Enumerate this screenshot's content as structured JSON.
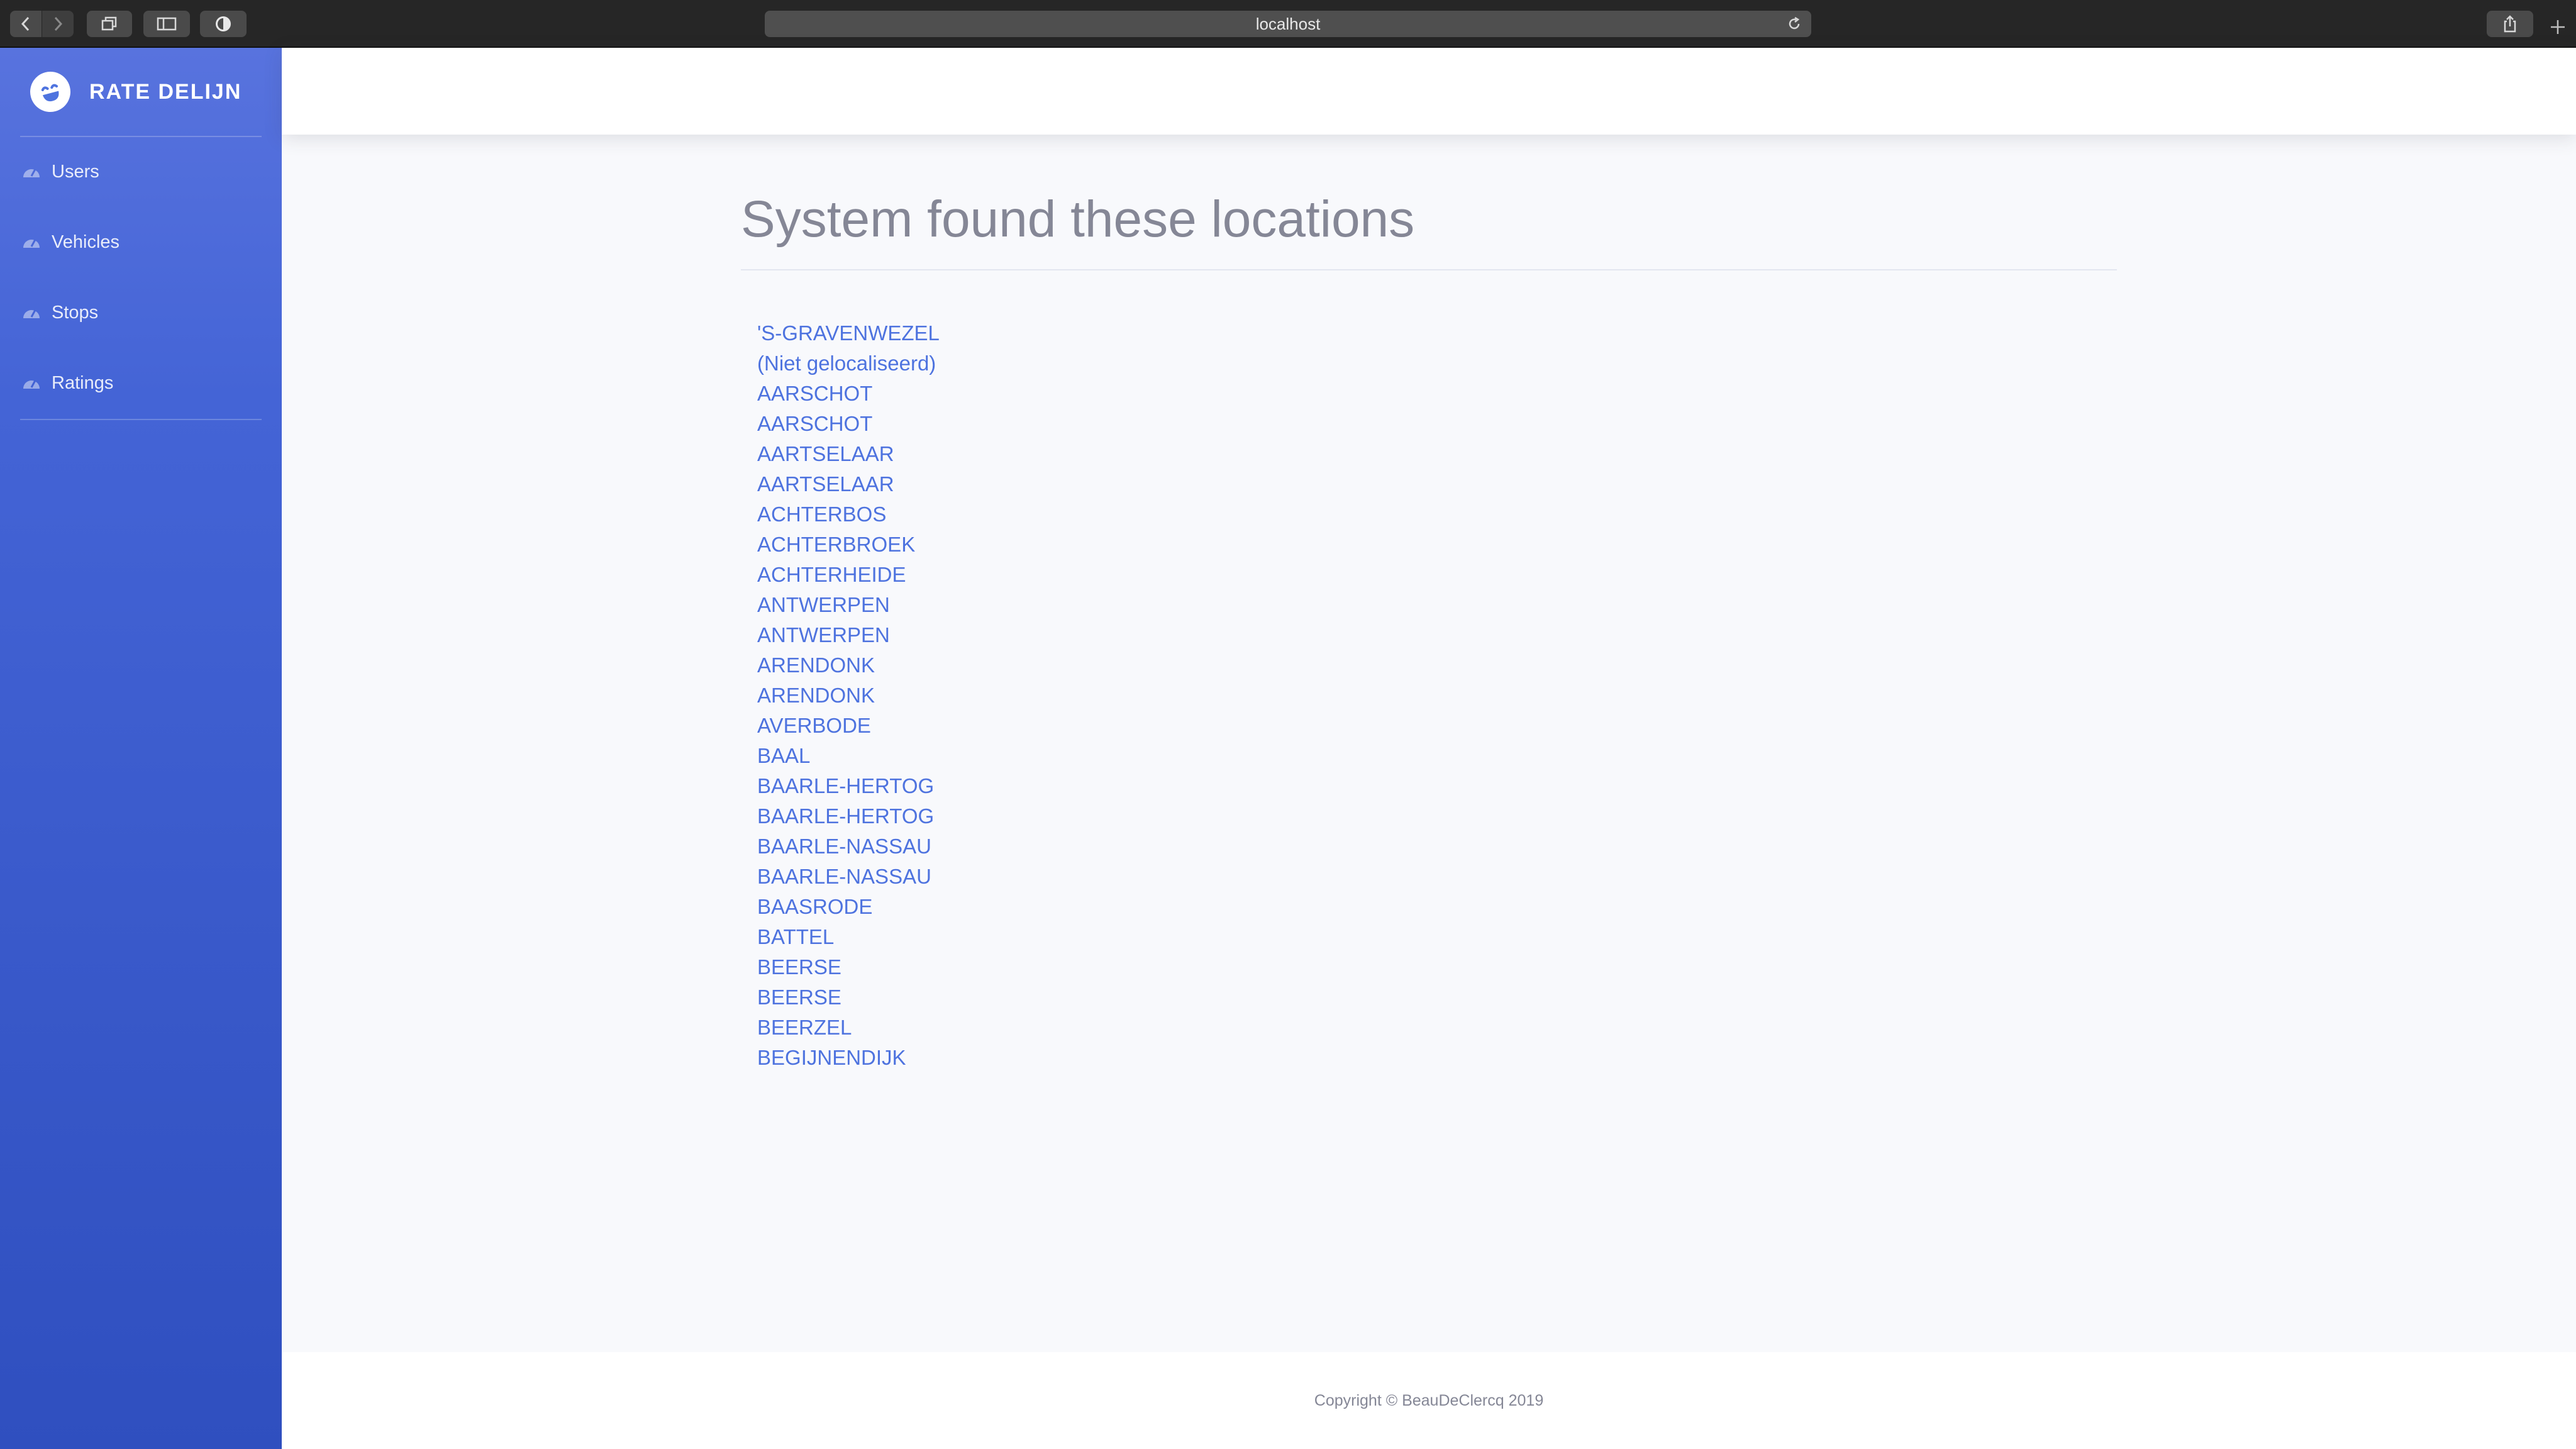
{
  "browser": {
    "url": "localhost"
  },
  "sidebar": {
    "brand": "RATE DELIJN",
    "items": [
      {
        "label": "Users"
      },
      {
        "label": "Vehicles"
      },
      {
        "label": "Stops"
      },
      {
        "label": "Ratings"
      }
    ]
  },
  "main": {
    "title": "System found these locations",
    "locations": [
      "'S-GRAVENWEZEL",
      "(Niet gelocaliseerd)",
      "AARSCHOT",
      "AARSCHOT",
      "AARTSELAAR",
      "AARTSELAAR",
      "ACHTERBOS",
      "ACHTERBROEK",
      "ACHTERHEIDE",
      "ANTWERPEN",
      "ANTWERPEN",
      "ARENDONK",
      "ARENDONK",
      "AVERBODE",
      "BAAL",
      "BAARLE-HERTOG",
      "BAARLE-HERTOG",
      "BAARLE-NASSAU",
      "BAARLE-NASSAU",
      "BAASRODE",
      "BATTEL",
      "BEERSE",
      "BEERSE",
      "BEERZEL",
      "BEGIJNENDIJK"
    ]
  },
  "footer": {
    "copyright": "Copyright © BeauDeClercq 2019"
  },
  "colors": {
    "sidebar_top": "#5873de",
    "sidebar_bottom": "#2f4fbf",
    "link": "#4e73df",
    "title": "#858796",
    "background": "#f8f9fc"
  }
}
